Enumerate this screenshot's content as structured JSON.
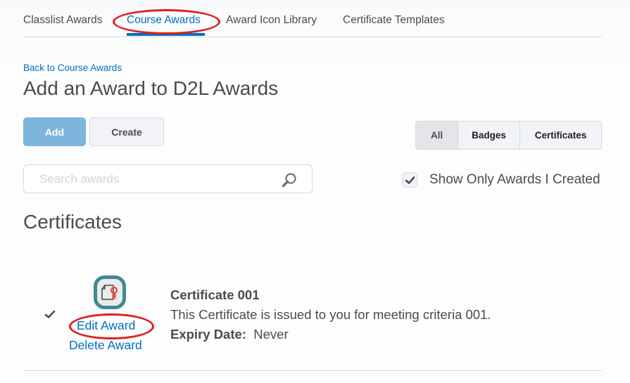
{
  "tabs": [
    {
      "label": "Classlist Awards",
      "active": false
    },
    {
      "label": "Course Awards",
      "active": true
    },
    {
      "label": "Award Icon Library",
      "active": false
    },
    {
      "label": "Certificate Templates",
      "active": false
    }
  ],
  "back_link": "Back to Course Awards",
  "page_title": "Add an Award to D2L Awards",
  "buttons": {
    "add": "Add",
    "create": "Create"
  },
  "filters": {
    "options": [
      "All",
      "Badges",
      "Certificates"
    ],
    "selected": "All"
  },
  "search": {
    "placeholder": "Search awards",
    "value": ""
  },
  "show_only_mine": {
    "label": "Show Only Awards I Created",
    "checked": true
  },
  "section_title": "Certificates",
  "awards": [
    {
      "selected": true,
      "icon": "certificate-icon",
      "edit_label": "Edit Award",
      "delete_label": "Delete Award",
      "title": "Certificate 001",
      "description": "This Certificate is issued to you for meeting criteria 001.",
      "expiry_label": "Expiry Date:",
      "expiry_value": "Never"
    }
  ],
  "colors": {
    "link": "#006fbf",
    "primary_button": "#7eb5dc",
    "annotation": "#e01e1e",
    "icon_teal": "#3f8a94",
    "ribbon_red": "#e0504f"
  }
}
